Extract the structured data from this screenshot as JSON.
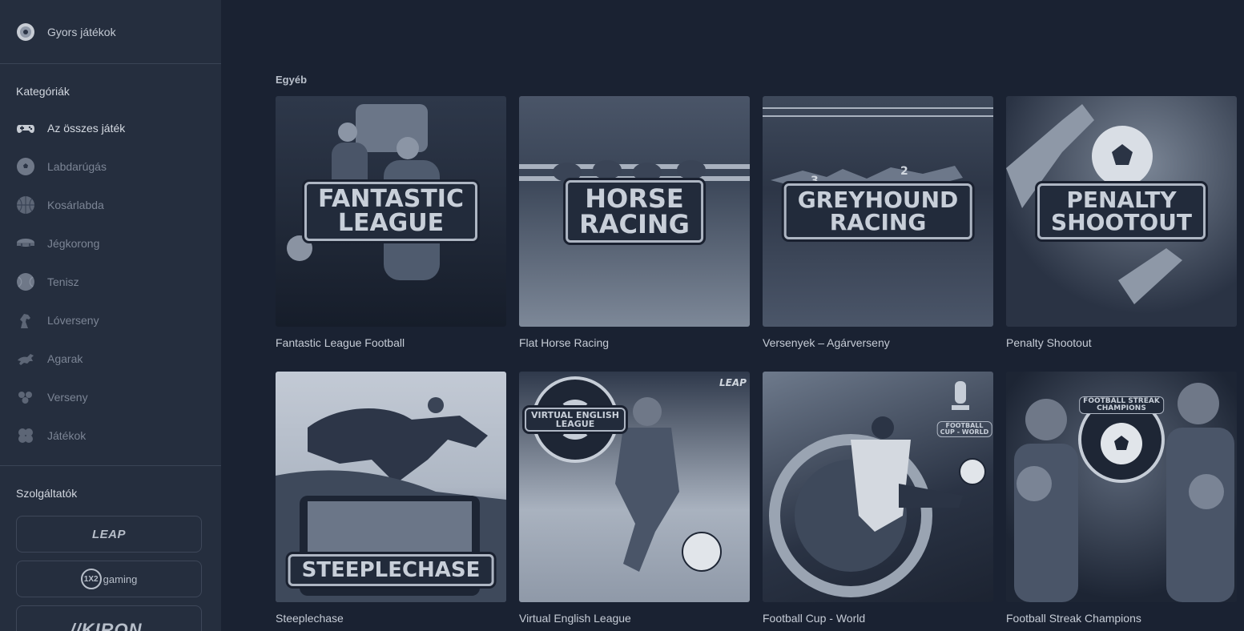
{
  "sidebar": {
    "quick_games": "Gyors játékok",
    "categories_title": "Kategóriák",
    "categories": [
      {
        "label": "Az összes játék",
        "icon": "gamepad-icon",
        "active": true
      },
      {
        "label": "Labdarúgás",
        "icon": "soccer-ball-icon",
        "active": false
      },
      {
        "label": "Kosárlabda",
        "icon": "basketball-icon",
        "active": false
      },
      {
        "label": "Jégkorong",
        "icon": "hockey-icon",
        "active": false
      },
      {
        "label": "Tenisz",
        "icon": "tennis-ball-icon",
        "active": false
      },
      {
        "label": "Lóverseny",
        "icon": "horse-icon",
        "active": false
      },
      {
        "label": "Agarak",
        "icon": "greyhound-icon",
        "active": false
      },
      {
        "label": "Verseny",
        "icon": "race-icon",
        "active": false
      },
      {
        "label": "Játékok",
        "icon": "games-icon",
        "active": false
      }
    ],
    "providers_title": "Szolgáltatók",
    "providers": [
      {
        "name": "LEAP",
        "logo": "LEAP"
      },
      {
        "name": "1X2 gaming",
        "logo_circle": "1X2",
        "logo_text": "gaming"
      },
      {
        "name": "KIRON",
        "logo": "//KIRON."
      }
    ]
  },
  "main": {
    "group_title": "Egyéb",
    "games": [
      {
        "title": "Fantastic League Football",
        "banner": [
          "FANTASTIC",
          "LEAGUE"
        ]
      },
      {
        "title": "Flat Horse Racing",
        "banner": [
          "HORSE",
          "RACING"
        ]
      },
      {
        "title": "Versenyek – Agárverseny",
        "banner": [
          "GREYHOUND",
          "RACING"
        ]
      },
      {
        "title": "Penalty Shootout",
        "banner": [
          "PENALTY",
          "SHOOTOUT"
        ]
      },
      {
        "title": "Steeplechase",
        "banner": [
          "STEEPLECHASE"
        ]
      },
      {
        "title": "Virtual English League",
        "banner": [
          "VIRTUAL ENGLISH",
          "LEAGUE"
        ]
      },
      {
        "title": "Football Cup - World",
        "banner": [
          "FOOTBALL",
          "CUP - WORLD"
        ]
      },
      {
        "title": "Football Streak Champions",
        "banner": [
          "FOOTBALL STREAK",
          "CHAMPIONS"
        ]
      }
    ]
  },
  "colors": {
    "background": "#1a2232",
    "sidebar": "#252e3e",
    "text_active": "#d6dbe3",
    "text_muted": "#7c8595"
  }
}
